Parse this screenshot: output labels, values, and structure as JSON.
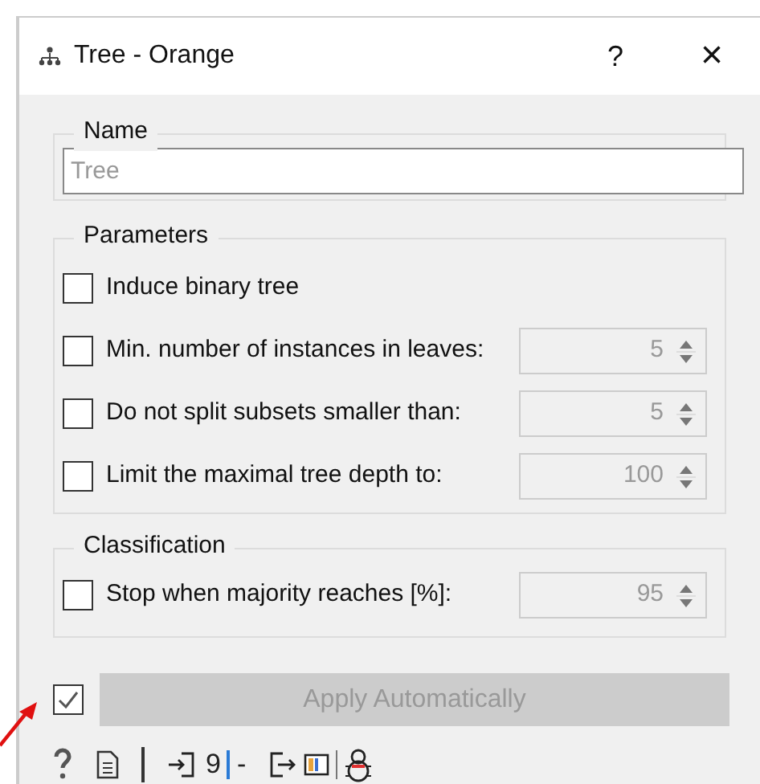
{
  "window": {
    "title": "Tree - Orange",
    "help": "?",
    "close": "×"
  },
  "name_box": {
    "title": "Name",
    "field": {
      "placeholder": "Tree"
    }
  },
  "parameters": {
    "title": "Parameters",
    "options": [
      {
        "kind": "checkbox",
        "label": "Induce binary tree",
        "checked": false
      },
      {
        "kind": "spin",
        "label": "Min. number of instances in leaves:",
        "checked": false,
        "value": "5",
        "disabled": true
      },
      {
        "kind": "spin",
        "label": "Do not split subsets smaller than:",
        "checked": false,
        "value": "5",
        "disabled": true
      },
      {
        "kind": "spin",
        "label": "Limit the maximal tree depth to:",
        "checked": false,
        "value": "100",
        "disabled": true
      }
    ]
  },
  "classification": {
    "title": "Classification",
    "options": [
      {
        "kind": "spin",
        "label": "Stop when majority reaches [%]:",
        "checked": false,
        "value": "95",
        "disabled": true
      }
    ]
  },
  "apply": {
    "auto_checked": true,
    "label": "Apply Automatically",
    "disabled": true
  },
  "status_bar": {
    "input_count": "9",
    "output_count": "-"
  },
  "annotation": {
    "kind": "arrow"
  }
}
